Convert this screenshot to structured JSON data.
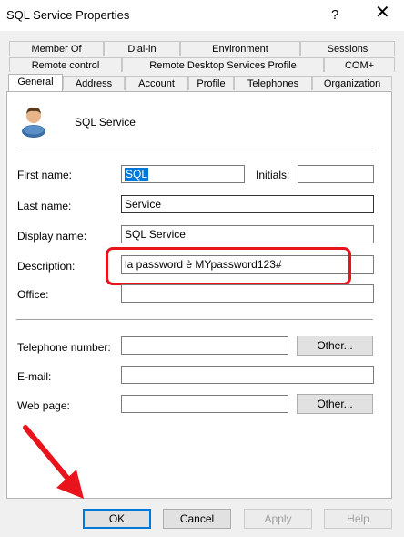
{
  "window": {
    "title": "SQL Service Properties",
    "help_glyph": "?",
    "close_glyph": "✕"
  },
  "tabs": {
    "row1": [
      "Member Of",
      "Dial-in",
      "Environment",
      "Sessions"
    ],
    "row2": [
      "Remote control",
      "Remote Desktop Services Profile",
      "COM+"
    ],
    "row3": [
      "General",
      "Address",
      "Account",
      "Profile",
      "Telephones",
      "Organization"
    ],
    "active": "General"
  },
  "general": {
    "display_header": "SQL Service",
    "first_name_label": "First name:",
    "first_name_value": "SQL",
    "initials_label": "Initials:",
    "initials_value": "",
    "last_name_label": "Last name:",
    "last_name_value": "Service",
    "display_name_label": "Display name:",
    "display_name_value": "SQL Service",
    "description_label": "Description:",
    "description_value": "la password è MYpassword123#",
    "office_label": "Office:",
    "office_value": "",
    "telephone_label": "Telephone number:",
    "telephone_value": "",
    "email_label": "E-mail:",
    "email_value": "",
    "webpage_label": "Web page:",
    "webpage_value": "",
    "other_label": "Other..."
  },
  "buttons": {
    "ok": "OK",
    "cancel": "Cancel",
    "apply": "Apply",
    "help": "Help"
  },
  "colors": {
    "highlight": "#e8131b",
    "selection": "#0078d7",
    "panel_bg": "#f0f0f0"
  },
  "icons": [
    "user-icon",
    "red-arrow-annotation",
    "close-icon",
    "help-icon"
  ]
}
